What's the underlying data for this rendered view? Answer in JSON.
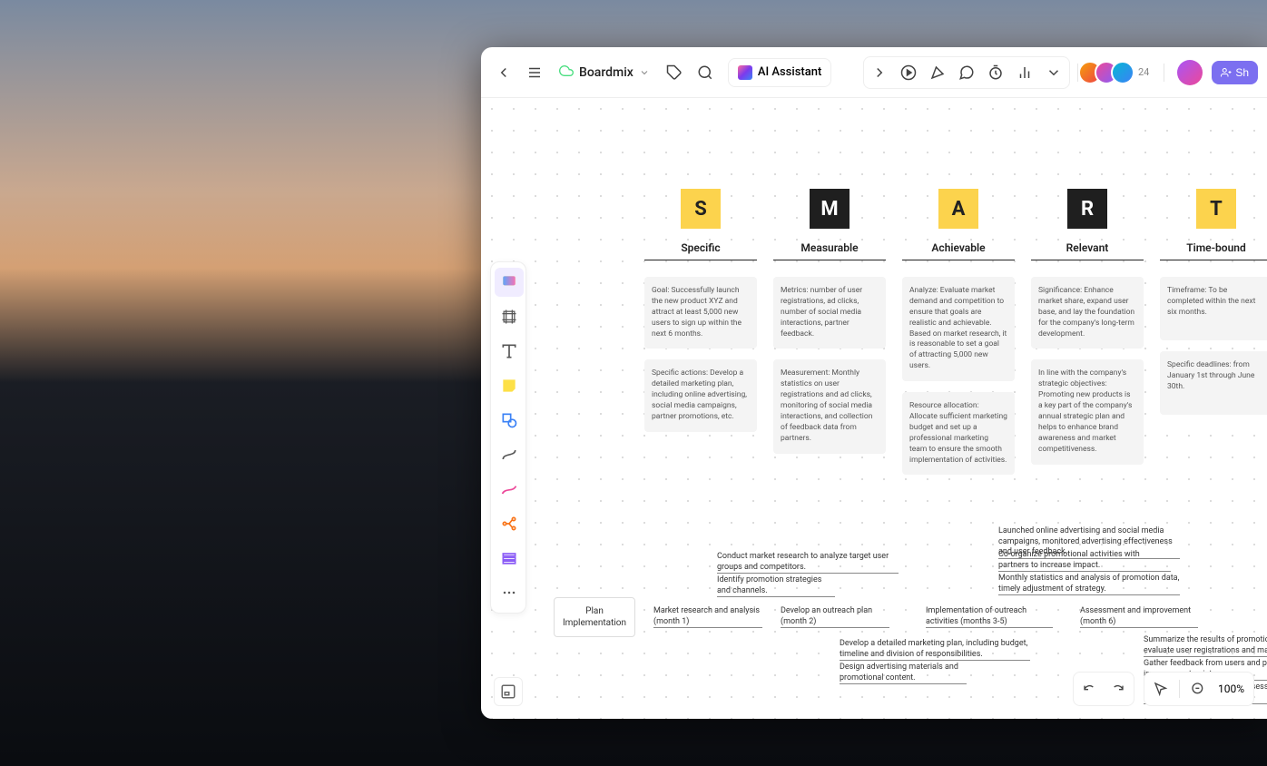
{
  "header": {
    "brand": "Boardmix",
    "ai_label": "AI Assistant",
    "avatar_count": "24",
    "share_label": "Sh"
  },
  "smart": [
    {
      "letter": "S",
      "style": "yellow",
      "title": "Specific",
      "note1": "Goal: Successfully launch the new product XYZ and attract at least 5,000 new users to sign up within the next 6 months.",
      "note2": "Specific actions: Develop a detailed marketing plan, including online advertising, social media campaigns, partner promotions, etc."
    },
    {
      "letter": "M",
      "style": "dark",
      "title": "Measurable",
      "note1": "Metrics: number of user registrations, ad clicks, number of social media interactions, partner feedback.",
      "note2": "Measurement: Monthly statistics on user registrations and ad clicks, monitoring of social media interactions, and collection of feedback data from partners."
    },
    {
      "letter": "A",
      "style": "yellow",
      "title": "Achievable",
      "note1": "Analyze: Evaluate market demand and competition to ensure that goals are realistic and achievable. Based on market research, it is reasonable to set a goal of attracting 5,000 new users.",
      "note2": "Resource allocation: Allocate sufficient marketing budget and set up a professional marketing team to ensure the smooth implementation of activities."
    },
    {
      "letter": "R",
      "style": "dark",
      "title": "Relevant",
      "note1": "Significance: Enhance market share, expand user base, and lay the foundation for the company's long-term development.",
      "note2": "In line with the company's strategic objectives: Promoting new products is a key part of the company's annual strategic plan and helps to enhance brand awareness and market competitiveness."
    },
    {
      "letter": "T",
      "style": "yellow",
      "title": "Time-bound",
      "note1": "Timeframe: To be completed within the next six months.",
      "note2": "Specific deadlines: from January 1st through June 30th."
    }
  ],
  "mindmap": {
    "root": "Plan Implementation",
    "b1": "Market research and analysis (month 1)",
    "b1a": "Conduct market research to analyze target user groups and competitors.",
    "b1b": "Identify promotion strategies and channels.",
    "b2": "Develop an outreach plan (month 2)",
    "b2a": "Develop a detailed marketing plan, including budget, timeline and division of responsibilities.",
    "b2b": "Design advertising materials and promotional content.",
    "b3": "Implementation of outreach activities (months 3-5)",
    "b3a": "Launched online advertising and social media campaigns, monitored advertising effectiveness and user feedback.",
    "b3b": "Co-organize promotional activities with partners to increase impact.",
    "b3c": "Monthly statistics and analysis of promotion data, timely adjustment of strategy.",
    "b4": "Assessment and improvement (month 6)",
    "b4a": "Summarize the results of promotional ac evaluate user registrations and market sh",
    "b4b": "Gather feedback from users and partners improvement points.",
    "b4c": "Based on the results of the assessment, o marketing plan."
  },
  "zoom": "100%"
}
